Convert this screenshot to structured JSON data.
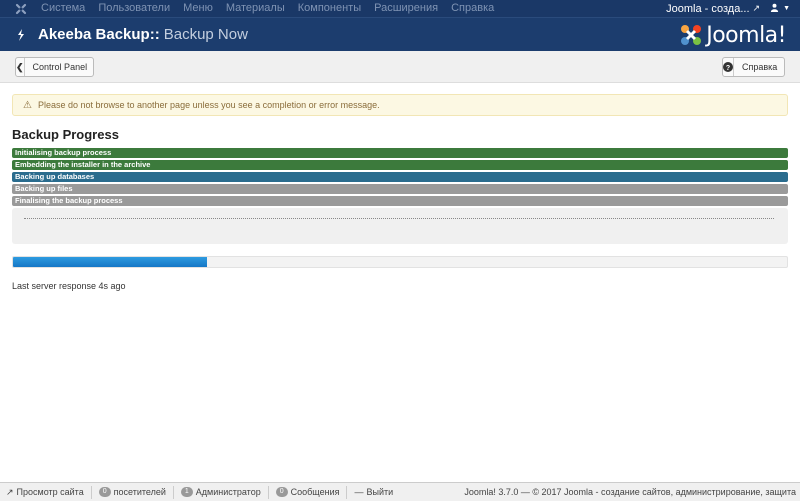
{
  "topbar": {
    "menu": [
      "Система",
      "Пользователи",
      "Меню",
      "Материалы",
      "Компоненты",
      "Расширения",
      "Справка"
    ],
    "site_link": "Joomla - созда...",
    "icons": [
      "joomla-icon",
      "external-link-icon",
      "user-icon",
      "caret-down-icon"
    ]
  },
  "header": {
    "title_part1": "Akeeba Backup::",
    "title_part2": "Backup Now",
    "brand": "Joomla!"
  },
  "toolbar": {
    "back_label": "Control Panel",
    "help_label": "Справка"
  },
  "alert": {
    "message": "Please do not browse to another page unless you see a completion or error message."
  },
  "progress_section": {
    "title": "Backup Progress",
    "steps": [
      {
        "label": "Initialising backup process",
        "state": "done",
        "color": "#3c7a3c"
      },
      {
        "label": "Embedding the installer in the archive",
        "state": "done",
        "color": "#3c7a3c"
      },
      {
        "label": "Backing up databases",
        "state": "active",
        "color": "#2a6c8e"
      },
      {
        "label": "Backing up files",
        "state": "pending",
        "color": "#9a9a9a"
      },
      {
        "label": "Finalising the backup process",
        "state": "pending",
        "color": "#9a9a9a"
      }
    ],
    "progress_percent": 25,
    "last_response": "Last server response 4s ago"
  },
  "footer": {
    "view_site": "Просмотр сайта",
    "visitors_count": "0",
    "visitors_label": "посетителей",
    "admins_count": "1",
    "admins_label": "Администратор",
    "messages_count": "0",
    "messages_label": "Сообщения",
    "logout": "Выйти",
    "copyright": "Joomla! 3.7.0 — © 2017 Joomla - создание сайтов, администрирование, защита"
  },
  "colors": {
    "topbar": "#1a3867",
    "header": "#1c3d6e",
    "progress_fill": "#1a84d1",
    "alert_bg": "#fcf8e3"
  }
}
